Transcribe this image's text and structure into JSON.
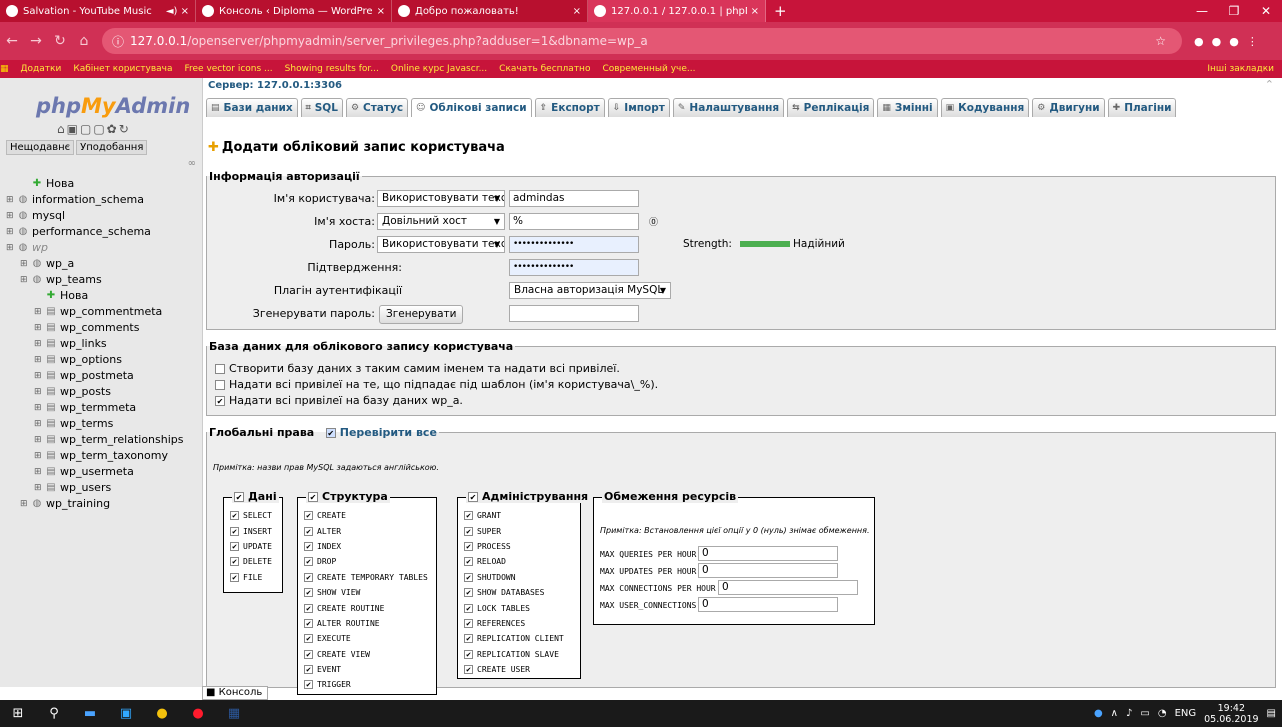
{
  "browser": {
    "tabs": [
      {
        "title": "Salvation - YouTube Music",
        "extra": "◄) ×"
      },
      {
        "title": "Консоль ‹ Diploma — WordPress",
        "extra": "×"
      },
      {
        "title": "Добро пожаловать!",
        "extra": "×"
      },
      {
        "title": "127.0.0.1 / 127.0.0.1 | phpMyAdm",
        "extra": "×"
      }
    ],
    "new_tab": "+",
    "window_controls": [
      "—",
      "❐",
      "✕"
    ],
    "url_host": "127.0.0.1",
    "url_path": "/openserver/phpmyadmin/server_privileges.php?adduser=1&dbname=wp_a",
    "bookmarks": [
      "Додатки",
      "Кабінет користувача",
      "Free vector icons ...",
      "Showing results for...",
      "Online курс Javascr...",
      "Скачать бесплатно",
      "Современный уче..."
    ],
    "bookmarks_right": "Інші закладки"
  },
  "sidebar": {
    "logo_php": "php",
    "logo_my": "My",
    "logo_admin": "Admin",
    "recent": "Нещодавнє",
    "favorites": "Уподобання",
    "tree": [
      {
        "label": "Нова",
        "depth": 1,
        "type": "new"
      },
      {
        "label": "information_schema",
        "depth": 0,
        "type": "db"
      },
      {
        "label": "mysql",
        "depth": 0,
        "type": "db"
      },
      {
        "label": "performance_schema",
        "depth": 0,
        "type": "db"
      },
      {
        "label": "wp",
        "depth": 0,
        "type": "db"
      },
      {
        "label": "wp_a",
        "depth": 1,
        "type": "db"
      },
      {
        "label": "wp_teams",
        "depth": 1,
        "type": "db"
      },
      {
        "label": "Нова",
        "depth": 2,
        "type": "new"
      },
      {
        "label": "wp_commentmeta",
        "depth": 2,
        "type": "table"
      },
      {
        "label": "wp_comments",
        "depth": 2,
        "type": "table"
      },
      {
        "label": "wp_links",
        "depth": 2,
        "type": "table"
      },
      {
        "label": "wp_options",
        "depth": 2,
        "type": "table"
      },
      {
        "label": "wp_postmeta",
        "depth": 2,
        "type": "table"
      },
      {
        "label": "wp_posts",
        "depth": 2,
        "type": "table"
      },
      {
        "label": "wp_termmeta",
        "depth": 2,
        "type": "table"
      },
      {
        "label": "wp_terms",
        "depth": 2,
        "type": "table"
      },
      {
        "label": "wp_term_relationships",
        "depth": 2,
        "type": "table"
      },
      {
        "label": "wp_term_taxonomy",
        "depth": 2,
        "type": "table"
      },
      {
        "label": "wp_usermeta",
        "depth": 2,
        "type": "table"
      },
      {
        "label": "wp_users",
        "depth": 2,
        "type": "table"
      },
      {
        "label": "wp_training",
        "depth": 1,
        "type": "db"
      }
    ]
  },
  "main": {
    "server": "Сервер: 127.0.0.1:3306",
    "tabs": [
      "Бази даних",
      "SQL",
      "Статус",
      "Облікові записи",
      "Експорт",
      "Імпорт",
      "Налаштування",
      "Реплікація",
      "Змінні",
      "Кодування",
      "Двигуни",
      "Плагіни"
    ],
    "heading": "Додати обліковий запис користувача",
    "login": {
      "legend": "Інформація авторизації",
      "user_label": "Ім'я користувача:",
      "user_mode": "Використовувати текс",
      "user_value": "admindas",
      "host_label": "Ім'я хоста:",
      "host_mode": "Довільний хост",
      "host_value": "%",
      "pass_label": "Пароль:",
      "pass_mode": "Використовувати текс",
      "pass_value": "••••••••••••••",
      "strength_label": "Strength:",
      "strength_text": "Надійний",
      "confirm_label": "Підтвердження:",
      "confirm_value": "••••••••••••••",
      "plugin_label": "Плагін аутентифікації",
      "plugin_value": "Власна авторизація MySQL",
      "gen_label": "Згенерувати пароль:",
      "gen_button": "Згенерувати"
    },
    "dbsection": {
      "legend": "База даних для облікового запису користувача",
      "opt1": "Створити базу даних з таким самим іменем та надати всі привілеї.",
      "opt2": "Надати всі привілеї на те, що підпадає під шаблон (ім'я користувача\\_%).",
      "opt3": "Надати всі привілеї на базу даних wp_a."
    },
    "global": {
      "legend": "Глобальні права",
      "check_all": "Перевірити все",
      "note": "Примітка: назви прав MySQL задаються англійською.",
      "data_legend": "Дані",
      "data": [
        "SELECT",
        "INSERT",
        "UPDATE",
        "DELETE",
        "FILE"
      ],
      "struct_legend": "Структура",
      "struct": [
        "CREATE",
        "ALTER",
        "INDEX",
        "DROP",
        "CREATE TEMPORARY TABLES",
        "SHOW VIEW",
        "CREATE ROUTINE",
        "ALTER ROUTINE",
        "EXECUTE",
        "CREATE VIEW",
        "EVENT",
        "TRIGGER"
      ],
      "admin_legend": "Адміністрування",
      "admin": [
        "GRANT",
        "SUPER",
        "PROCESS",
        "RELOAD",
        "SHUTDOWN",
        "SHOW DATABASES",
        "LOCK TABLES",
        "REFERENCES",
        "REPLICATION CLIENT",
        "REPLICATION SLAVE",
        "CREATE USER"
      ],
      "res_legend": "Обмеження ресурсів",
      "res_note": "Примітка: Встановлення цієї опції у 0 (нуль) знімає обмеження.",
      "res": [
        {
          "label": "MAX QUERIES PER HOUR",
          "value": "0"
        },
        {
          "label": "MAX UPDATES PER HOUR",
          "value": "0"
        },
        {
          "label": "MAX CONNECTIONS PER HOUR",
          "value": "0"
        },
        {
          "label": "MAX USER_CONNECTIONS",
          "value": "0"
        }
      ]
    },
    "console": "Консоль"
  },
  "taskbar": {
    "lang": "ENG",
    "time": "19:42",
    "date": "05.06.2019"
  },
  "colors": {
    "chrome": "#c7143a",
    "strength": "#4caf50",
    "link": "#235a81"
  }
}
